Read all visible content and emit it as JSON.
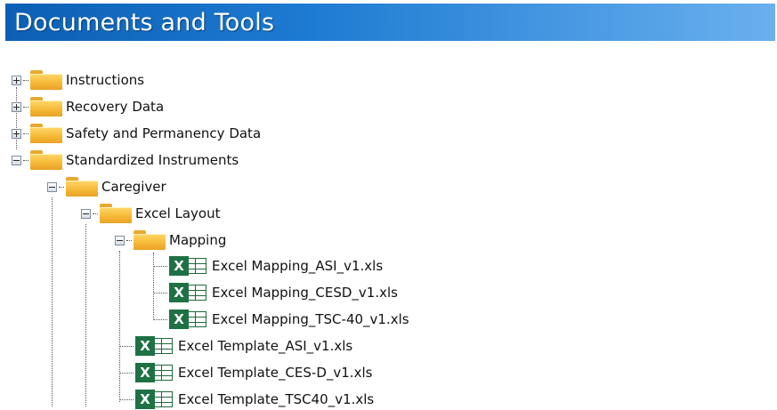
{
  "header": {
    "title": "Documents and Tools"
  },
  "tree": {
    "instructions": "Instructions",
    "recovery": "Recovery Data",
    "safety": "Safety and Permanency Data",
    "standardized": "Standardized Instruments",
    "caregiver": "Caregiver",
    "excel_layout": "Excel Layout",
    "mapping": "Mapping",
    "files": [
      "Excel Mapping_ASI_v1.xls",
      "Excel Mapping_CESD_v1.xls",
      "Excel Mapping_TSC-40_v1.xls",
      "Excel Template_ASI_v1.xls",
      "Excel Template_CES-D_v1.xls",
      "Excel Template_TSC40_v1.xls"
    ]
  },
  "icons": {
    "folder": "folder-icon",
    "excel": "excel-file-icon",
    "expand": "plus-box-icon",
    "collapse": "minus-box-icon"
  },
  "colors": {
    "header_start": "#0c5fb4",
    "header_end": "#6ab0ee",
    "folder": "#f5b735",
    "excel": "#1e7145"
  }
}
